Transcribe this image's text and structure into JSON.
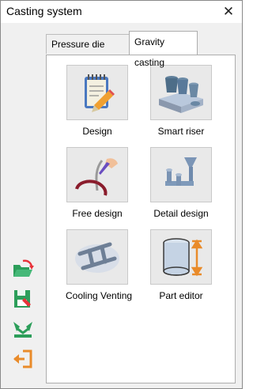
{
  "window": {
    "title": "Casting system",
    "close_symbol": "✕"
  },
  "tabs": [
    {
      "label": "Pressure die casting",
      "active": false
    },
    {
      "label": "Gravity casting",
      "active": true
    }
  ],
  "tools": [
    {
      "label": "Design",
      "icon": "notepad-pencil-icon"
    },
    {
      "label": "Smart riser",
      "icon": "riser-casting-icon"
    },
    {
      "label": "Free design",
      "icon": "hand-drawing-icon"
    },
    {
      "label": "Detail design",
      "icon": "runner-system-icon"
    },
    {
      "label": "Cooling  Venting",
      "icon": "cooling-pipes-icon"
    },
    {
      "label": "Part editor",
      "icon": "cylinder-dimension-icon"
    }
  ],
  "sidebar": [
    {
      "name": "open-folder-icon"
    },
    {
      "name": "save-icon"
    },
    {
      "name": "recycle-icon"
    },
    {
      "name": "exit-icon"
    }
  ],
  "colors": {
    "accent_red": "#e8333a",
    "accent_green": "#2c9e5a",
    "accent_orange": "#e98b2a"
  }
}
